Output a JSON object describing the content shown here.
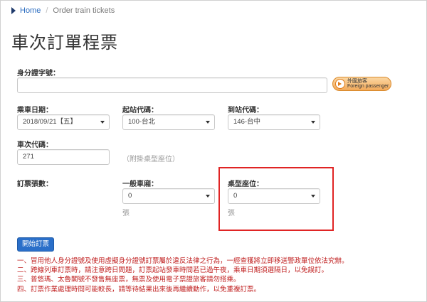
{
  "breadcrumb": {
    "home": "Home",
    "separator": "/",
    "current": "Order train tickets"
  },
  "page_title": "車次訂單程票",
  "form": {
    "id_label": "身分證字號：",
    "id_value": "",
    "foreign_button": {
      "line1": "外國旅客",
      "line2": "Foreign passenger"
    },
    "date_label": "乘車日期：",
    "date_value": "2018/09/21【五】",
    "from_label": "起站代碼：",
    "from_value": "100-台北",
    "to_label": "到站代碼：",
    "to_value": "146-台中",
    "train_label": "車次代碼：",
    "train_value": "271",
    "train_hint": "（附掛桌型座位）",
    "ticket_count_label": "訂票張數：",
    "regular_label": "一般車廂：",
    "regular_value": "0",
    "regular_unit": "張",
    "table_label": "桌型座位：",
    "table_value": "0",
    "table_unit": "張",
    "submit_label": "開始訂票"
  },
  "notes": [
    "一、冒用他人身分證號及使用虛擬身分證號訂票屬於違反法律之行為，一經查獲將立即移送警政單位依法究辦。",
    "二、跨線列車訂票時，請注意跨日問題，訂票起站發車時間若已過午夜，乘車日期須選隔日，以免誤訂。",
    "三、普悠瑪、太魯閣號不發售無座票，無票及使用電子票證旅客請勿搭乘。",
    "四、訂票作業處理時間可能較長，請等待結果出來後再繼續動作，以免重複訂票。"
  ],
  "colors": {
    "link": "#2a6cc0",
    "primary_button": "#2a6fc9",
    "notes_text": "#c02020",
    "highlight_border": "#e02424"
  }
}
